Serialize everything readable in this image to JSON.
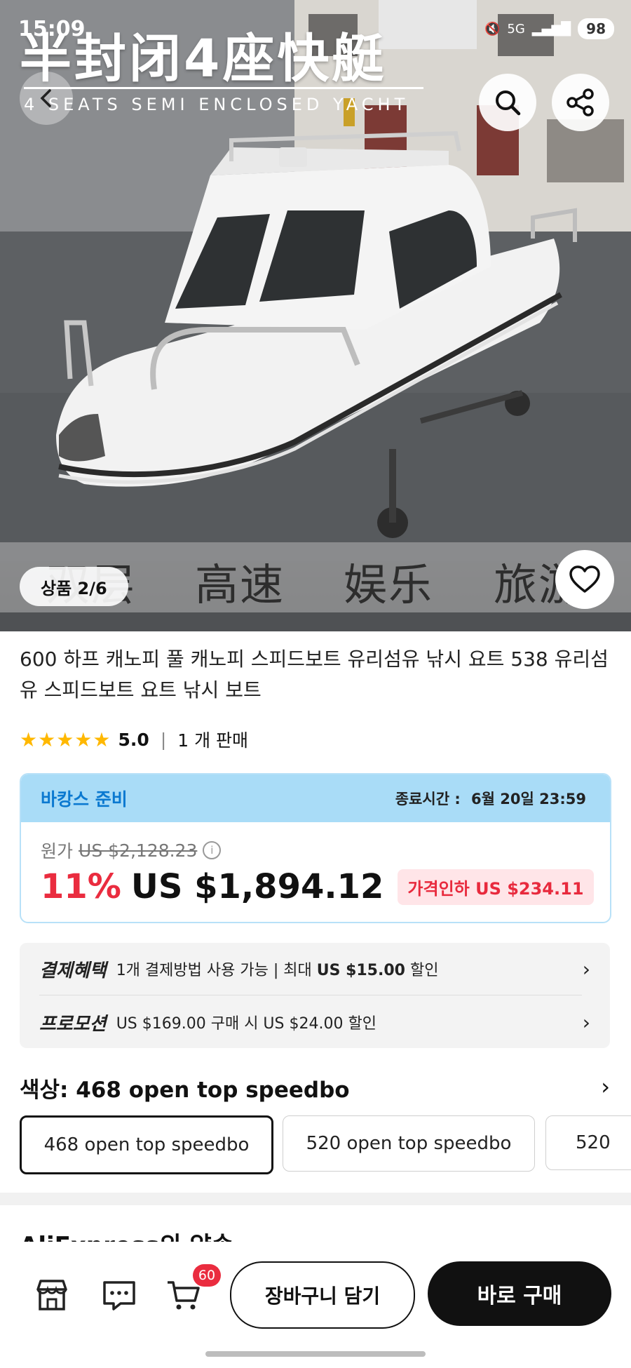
{
  "status_bar": {
    "time": "15:09",
    "network": "5G",
    "battery": "98"
  },
  "hero": {
    "title_cn": "半封闭4座快艇",
    "title_en": "4 SEATS SEMI ENCLOSED YACHT",
    "banner_words": [
      "双层",
      "高速",
      "娱乐",
      "旅游"
    ],
    "counter": "상품 2/6"
  },
  "product": {
    "title": "600 하프 캐노피 풀 캐노피 스피드보트 유리섬유 낚시 요트 538 유리섬유 스피드보트 요트 낚시 보트",
    "rating": "5.0",
    "stars": 5,
    "sold": "1 개 판매"
  },
  "price_card": {
    "promo_label": "바캉스 준비",
    "end_label": "종료시간 :",
    "end_time": "6월 20일 23:59",
    "original_label": "원가",
    "original_price": "US $2,128.23",
    "discount": "11%",
    "price": "US $1,894.12",
    "price_cut": "가격인하 US $234.11"
  },
  "benefits": [
    {
      "label": "결제혜택",
      "text_pre": "1개 결제방법 사용 가능 | 최대 ",
      "text_bold": "US $15.00",
      "text_post": " 할인"
    },
    {
      "label": "프로모션",
      "text_pre": "US $169.00 구매 시 US $24.00 할인",
      "text_bold": "",
      "text_post": ""
    }
  ],
  "color": {
    "heading": "색상: 468 open top speedbo",
    "options": [
      "468 open top speedbo",
      "520 open top speedbo",
      "520"
    ]
  },
  "section_next": "AliExpress의 약속",
  "bottom_bar": {
    "cart_count": "60",
    "add_to_cart": "장바구니 담기",
    "buy_now": "바로 구매"
  },
  "colors": {
    "accent_red": "#ea2c3f",
    "promo_blue": "#a9dcf7",
    "star": "#ffb800"
  }
}
